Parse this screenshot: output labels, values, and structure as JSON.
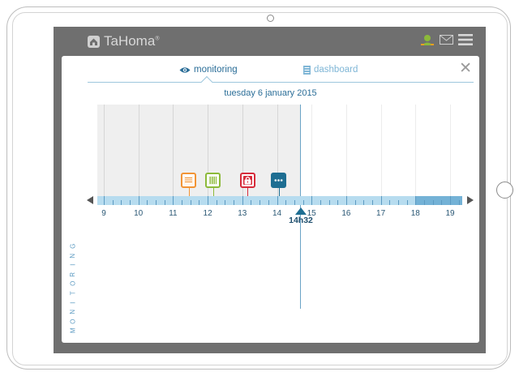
{
  "app": {
    "brand": "TaHoma",
    "brand_mark": "®"
  },
  "icons": {
    "logo": "home-logo-icon",
    "user": "user-status-icon",
    "mail": "mail-icon",
    "menu": "hamburger-menu-icon",
    "close": "close-icon",
    "eye": "eye-icon",
    "dashboard": "dashboard-list-icon"
  },
  "modal": {
    "tabs": [
      {
        "label": "monitoring",
        "active": true
      },
      {
        "label": "dashboard",
        "active": false
      }
    ],
    "close_label": "✕",
    "date": "tuesday 6 january 2015",
    "side_label": "MONITORING"
  },
  "timeline": {
    "hours": [
      "9",
      "10",
      "11",
      "12",
      "13",
      "14",
      "15",
      "16",
      "17",
      "18",
      "19"
    ],
    "cursor_time": "14h32",
    "events": [
      {
        "type": "roller-shutter",
        "hour": 11.45,
        "color": "#f29435"
      },
      {
        "type": "exterior-blind",
        "hour": 12.15,
        "color": "#8cba3a"
      },
      {
        "type": "alarm-lock",
        "hour": 13.15,
        "color": "#d62b3a"
      },
      {
        "type": "other",
        "hour": 14.05,
        "color": "#1e6e92"
      }
    ]
  },
  "colors": {
    "accent": "#2b6e98",
    "light_accent": "#7fb6d6",
    "scale": "#b7dcef",
    "frame": "#6f6f6f"
  }
}
